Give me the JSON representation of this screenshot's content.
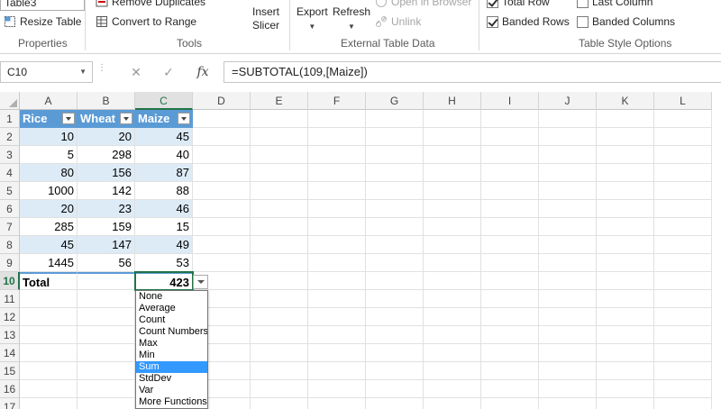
{
  "ribbon": {
    "table_name": "Table3",
    "properties": {
      "resize_table": "Resize Table",
      "label": "Properties"
    },
    "tools": {
      "remove_duplicates": "Remove Duplicates",
      "convert_to_range": "Convert to Range",
      "insert_slicer_line1": "Insert",
      "insert_slicer_line2": "Slicer",
      "label": "Tools"
    },
    "external": {
      "export": "Export",
      "refresh": "Refresh",
      "open_in_browser": "Open in Browser",
      "unlink": "Unlink",
      "label": "External Table Data"
    },
    "style_options": {
      "total_row": "Total Row",
      "banded_rows": "Banded Rows",
      "last_column": "Last Column",
      "banded_columns": "Banded Columns",
      "label": "Table Style Options",
      "total_row_checked": true,
      "banded_rows_checked": true,
      "last_column_checked": false,
      "banded_columns_checked": false
    }
  },
  "formula_bar": {
    "name_box": "C10",
    "cancel_glyph": "✕",
    "enter_glyph": "✓",
    "fx_label": "fx",
    "formula": "=SUBTOTAL(109,[Maize])"
  },
  "sheet": {
    "columns": [
      "A",
      "B",
      "C",
      "D",
      "E",
      "F",
      "G",
      "H",
      "I",
      "J",
      "K",
      "L"
    ],
    "rows": [
      "1",
      "2",
      "3",
      "4",
      "5",
      "6",
      "7",
      "8",
      "9",
      "10",
      "11",
      "12",
      "13",
      "14",
      "15",
      "16",
      "17"
    ],
    "headers": [
      "Rice",
      "Wheat",
      "Maize"
    ],
    "data": [
      [
        "10",
        "20",
        "45"
      ],
      [
        "5",
        "298",
        "40"
      ],
      [
        "80",
        "156",
        "87"
      ],
      [
        "1000",
        "142",
        "88"
      ],
      [
        "20",
        "23",
        "46"
      ],
      [
        "285",
        "159",
        "15"
      ],
      [
        "45",
        "147",
        "49"
      ],
      [
        "1445",
        "56",
        "53"
      ]
    ],
    "total_label": "Total",
    "total_value": "423"
  },
  "total_dropdown": {
    "options": [
      "None",
      "Average",
      "Count",
      "Count Numbers",
      "Max",
      "Min",
      "Sum",
      "StdDev",
      "Var",
      "More Functions..."
    ],
    "selected": "Sum"
  },
  "colors": {
    "table_header": "#5b9bd5",
    "band": "#ddebf7",
    "selection": "#217346",
    "dropdown_highlight": "#3399ff"
  }
}
